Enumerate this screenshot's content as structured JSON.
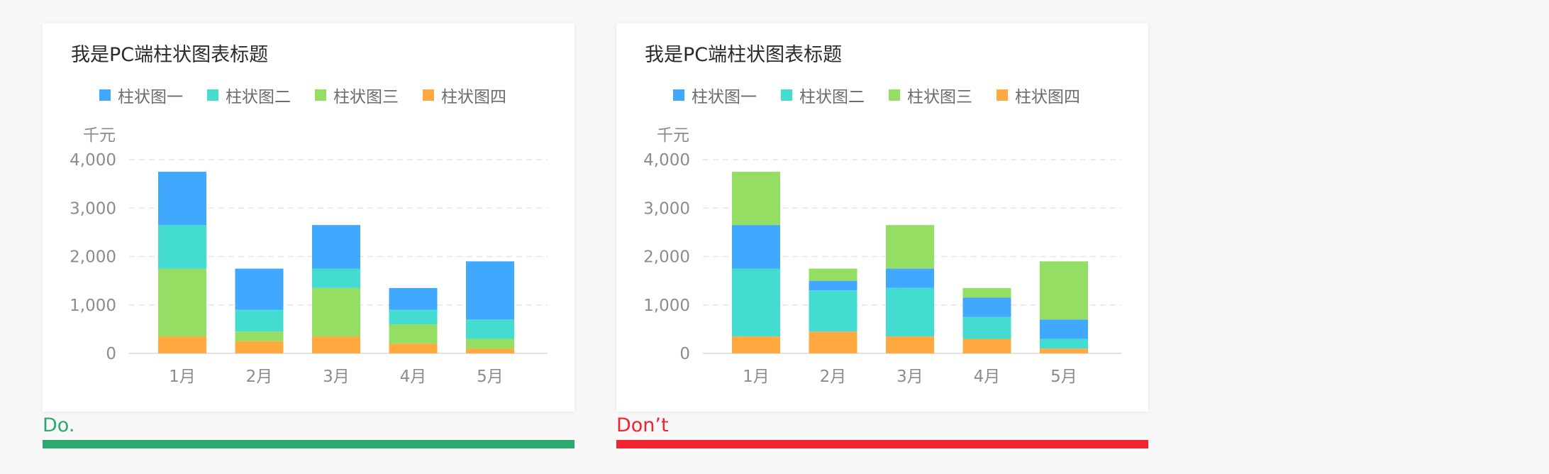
{
  "panels": [
    {
      "caption": "Do.",
      "color": "#2caa6e",
      "title": "我是PC端柱状图表标题",
      "unit": "千元",
      "legend": [
        "柱状图一",
        "柱状图二",
        "柱状图三",
        "柱状图四"
      ]
    },
    {
      "caption": "Don’t",
      "color": "#f0232e",
      "title": "我是PC端柱状图表标题",
      "unit": "千元",
      "legend": [
        "柱状图一",
        "柱状图二",
        "柱状图三",
        "柱状图四"
      ]
    }
  ],
  "series_colors": {
    "柱状图一": "#40a9ff",
    "柱状图二": "#44dbd0",
    "柱状图三": "#95de64",
    "柱状图四": "#ffa940"
  },
  "chart_data": [
    {
      "type": "bar",
      "stacked": true,
      "title": "我是PC端柱状图表标题",
      "ylabel": "千元",
      "ylim": [
        0,
        4000
      ],
      "yticks": [
        "0",
        "1,000",
        "2,000",
        "3,000",
        "4,000"
      ],
      "grid": true,
      "legend_position": "top",
      "categories": [
        "1月",
        "2月",
        "3月",
        "4月",
        "5月"
      ],
      "stack_order": [
        "柱状图四",
        "柱状图三",
        "柱状图二",
        "柱状图一"
      ],
      "series": [
        {
          "name": "柱状图一",
          "values": [
            1100,
            850,
            900,
            450,
            1200
          ]
        },
        {
          "name": "柱状图二",
          "values": [
            900,
            450,
            400,
            300,
            400
          ]
        },
        {
          "name": "柱状图三",
          "values": [
            1400,
            200,
            1000,
            400,
            200
          ]
        },
        {
          "name": "柱状图四",
          "values": [
            350,
            250,
            350,
            200,
            100
          ]
        }
      ]
    },
    {
      "type": "bar",
      "stacked": true,
      "title": "我是PC端柱状图表标题",
      "ylabel": "千元",
      "ylim": [
        0,
        4000
      ],
      "yticks": [
        "0",
        "1,000",
        "2,000",
        "3,000",
        "4,000"
      ],
      "grid": true,
      "legend_position": "top",
      "categories": [
        "1月",
        "2月",
        "3月",
        "4月",
        "5月"
      ],
      "stack_order": [
        "柱状图四",
        "柱状图二",
        "柱状图一",
        "柱状图三"
      ],
      "series": [
        {
          "name": "柱状图一",
          "values": [
            900,
            200,
            400,
            400,
            400
          ]
        },
        {
          "name": "柱状图二",
          "values": [
            1400,
            850,
            1000,
            450,
            200
          ]
        },
        {
          "name": "柱状图三",
          "values": [
            1100,
            250,
            900,
            200,
            1200
          ]
        },
        {
          "name": "柱状图四",
          "values": [
            350,
            450,
            350,
            300,
            100
          ]
        }
      ]
    }
  ]
}
